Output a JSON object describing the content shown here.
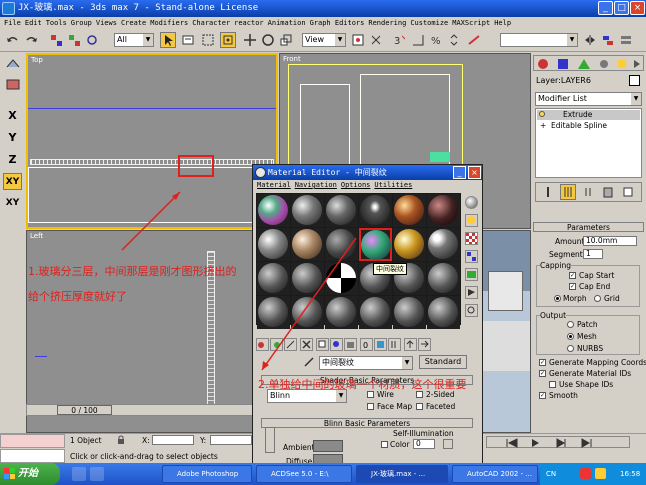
{
  "window": {
    "title": "JX-玻璃.max - 3ds max 7 - Stand-alone License"
  },
  "menu": [
    "File",
    "Edit",
    "Tools",
    "Group",
    "Views",
    "Create",
    "Modifiers",
    "Character",
    "reactor",
    "Animation",
    "Graph Editors",
    "Rendering",
    "Customize",
    "MAXScript",
    "Help"
  ],
  "toolbar": {
    "selection_filter": "All",
    "ref_coord": "View"
  },
  "left_tools": [
    "X",
    "Y",
    "Z",
    "XY",
    "XY"
  ],
  "viewports": {
    "top": "Top",
    "front": "Front",
    "left": "Left"
  },
  "timeline": {
    "frame": "0 / 100"
  },
  "status": {
    "selection": "1 Object",
    "x_label": "X:",
    "y_label": "Y:",
    "prompt": "Click or click-and-drag to select objects"
  },
  "material_editor": {
    "title": "Material Editor - 中间裂纹",
    "menu": [
      "Material",
      "Navigation",
      "Options",
      "Utilities"
    ],
    "tooltip": "中间裂纹",
    "material_name": "中间裂纹",
    "material_type": "Standard",
    "shader_section": "Shader Basic Parameters",
    "shader": "Blinn",
    "options": {
      "wire": "Wire",
      "two_sided": "2-Sided",
      "face_map": "Face Map",
      "faceted": "Faceted"
    },
    "blinn_section": "Blinn Basic Parameters",
    "self_illum": "Self-Illumination",
    "color_label": "Color",
    "color_value": "0",
    "ambient": "Ambient:",
    "diffuse": "Diffuse:"
  },
  "command_panel": {
    "layer": "Layer:LAYER6",
    "modifier_list": "Modifier List",
    "stack": [
      "Extrude",
      "Editable Spline"
    ],
    "params_title": "Parameters",
    "amount_label": "Amount:",
    "amount_value": "10.0mm",
    "segments_label": "Segments:",
    "segments_value": "1",
    "capping": "Capping",
    "cap_start": "Cap Start",
    "cap_end": "Cap End",
    "morph": "Morph",
    "grid": "Grid",
    "output": "Output",
    "patch": "Patch",
    "mesh": "Mesh",
    "nurbs": "NURBS",
    "gen_mapping": "Generate Mapping Coords.",
    "gen_material": "Generate Material IDs",
    "use_shape": "Use Shape IDs",
    "smooth": "Smooth"
  },
  "annotations": {
    "note1_line1": "1.玻璃分三层，中间那层是刚才图形挤出的",
    "note1_line2": "给个挤压厚度就好了",
    "note2": "2.单独给中间的玻璃一个材质，这个很重要"
  },
  "taskbar": {
    "start": "开始",
    "tasks": [
      "Adobe Photoshop",
      "ACDSee 5.0 - E:\\",
      "JX-玻璃.max - ...",
      "AutoCAD 2002 - ..."
    ],
    "lang": "CN",
    "clock": "16:58"
  }
}
